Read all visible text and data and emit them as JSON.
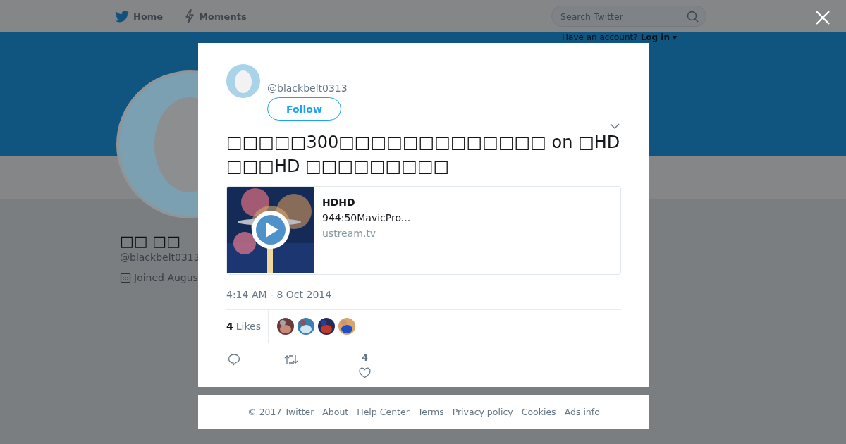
{
  "nav": {
    "items": [
      {
        "kind": "home",
        "label": "Home"
      },
      {
        "kind": "moments",
        "label": "Moments"
      }
    ],
    "search": {
      "placeholder": "Search Twitter"
    },
    "account_prompt": "Have an account?",
    "login": "Log in ▾"
  },
  "profile": {
    "name": "□□ □□",
    "handle": "@blackbelt0313",
    "joined": "Joined Augus"
  },
  "tweet": {
    "handle": "@blackbelt0313",
    "follow": "Follow",
    "text": "□□□□□300□□□□□□□□□□□□□ on □HD□□□HD □□□□□□□□□",
    "card": {
      "kind": "picture",
      "title": "HDHD",
      "description": "944:50MavicPro...",
      "domain": "ustream.tv"
    },
    "timestamp": "4:14 AM - 8 Oct 2014",
    "likes": {
      "count": "4",
      "label": "Likes"
    },
    "like_count": "4"
  },
  "footer": [
    "© 2017 Twitter",
    "About",
    "Help Center",
    "Terms",
    "Privacy policy",
    "Cookies",
    "Ads info"
  ]
}
